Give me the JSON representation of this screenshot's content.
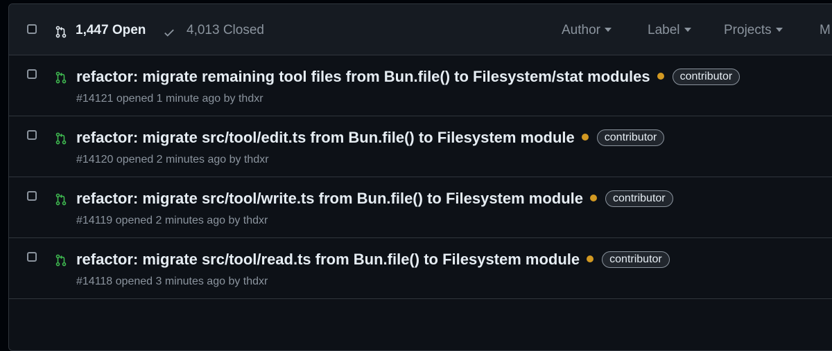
{
  "header": {
    "open_label": "1,447 Open",
    "closed_label": "4,013 Closed",
    "filters": [
      "Author",
      "Label",
      "Projects",
      "M"
    ]
  },
  "colors": {
    "open_green": "#3fb950",
    "status_dot": "#d29922",
    "muted": "#8b949e"
  },
  "pull_requests": [
    {
      "title": "refactor: migrate remaining tool files from Bun.file() to Filesystem/stat modules",
      "label": "contributor",
      "number": "#14121",
      "opened": "opened 1 minute ago by",
      "author": "thdxr"
    },
    {
      "title": "refactor: migrate src/tool/edit.ts from Bun.file() to Filesystem module",
      "label": "contributor",
      "number": "#14120",
      "opened": "opened 2 minutes ago by",
      "author": "thdxr"
    },
    {
      "title": "refactor: migrate src/tool/write.ts from Bun.file() to Filesystem module",
      "label": "contributor",
      "number": "#14119",
      "opened": "opened 2 minutes ago by",
      "author": "thdxr"
    },
    {
      "title": "refactor: migrate src/tool/read.ts from Bun.file() to Filesystem module",
      "label": "contributor",
      "number": "#14118",
      "opened": "opened 3 minutes ago by",
      "author": "thdxr"
    }
  ]
}
